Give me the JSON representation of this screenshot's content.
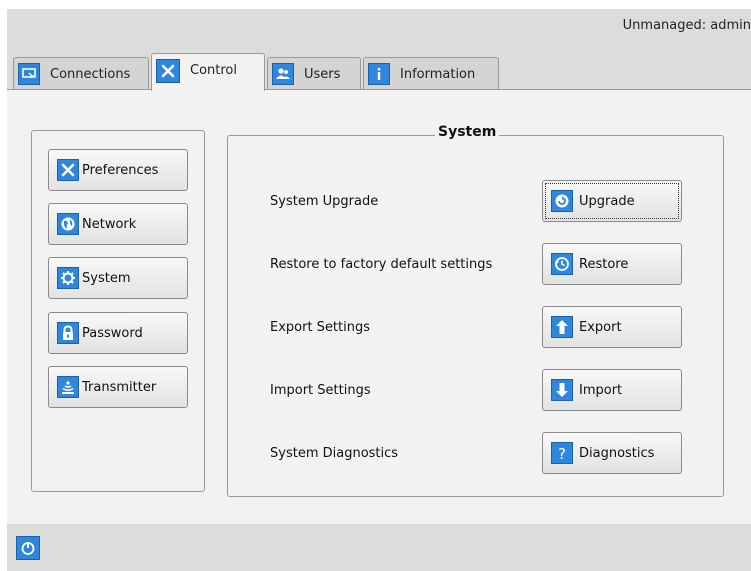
{
  "status": {
    "text": "Unmanaged: admin"
  },
  "tabs": [
    {
      "label": "Connections",
      "icon": "connections-icon"
    },
    {
      "label": "Control",
      "icon": "tools-icon",
      "active": true
    },
    {
      "label": "Users",
      "icon": "users-icon"
    },
    {
      "label": "Information",
      "icon": "info-icon"
    }
  ],
  "sidebar": {
    "items": [
      {
        "label": "Preferences",
        "icon": "tools-icon"
      },
      {
        "label": "Network",
        "icon": "globe-icon"
      },
      {
        "label": "System",
        "icon": "gear-icon"
      },
      {
        "label": "Password",
        "icon": "lock-icon"
      },
      {
        "label": "Transmitter",
        "icon": "transmitter-icon"
      }
    ]
  },
  "system": {
    "title": "System",
    "rows": [
      {
        "label": "System Upgrade",
        "button": "Upgrade",
        "icon": "upgrade-icon"
      },
      {
        "label": "Restore to factory default settings",
        "button": "Restore",
        "icon": "restore-icon"
      },
      {
        "label": "Export Settings",
        "button": "Export",
        "icon": "export-arrow-icon"
      },
      {
        "label": "Import Settings",
        "button": "Import",
        "icon": "import-arrow-icon"
      },
      {
        "label": "System Diagnostics",
        "button": "Diagnostics",
        "icon": "help-icon"
      }
    ]
  },
  "colors": {
    "accent": "#2e86de",
    "panel": "#f2f2f2",
    "frame": "#dcdcdc"
  },
  "footer": {
    "icon": "power-icon"
  }
}
